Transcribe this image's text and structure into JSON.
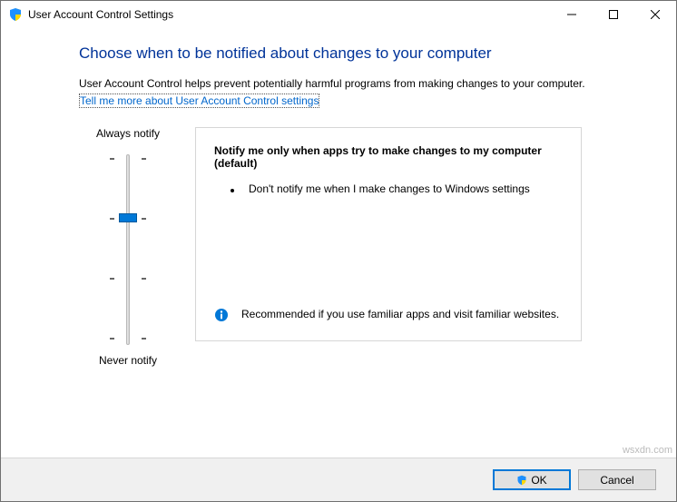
{
  "title": "User Account Control Settings",
  "heading": "Choose when to be notified about changes to your computer",
  "description": "User Account Control helps prevent potentially harmful programs from making changes to your computer.",
  "link": "Tell me more about User Account Control settings",
  "slider": {
    "top_label": "Always notify",
    "bottom_label": "Never notify",
    "levels": 4,
    "current_level": 2
  },
  "panel": {
    "title": "Notify me only when apps try to make changes to my computer (default)",
    "bullet": "Don't notify me when I make changes to Windows settings",
    "recommendation": "Recommended if you use familiar apps and visit familiar websites."
  },
  "buttons": {
    "ok": "OK",
    "cancel": "Cancel"
  },
  "watermark": "wsxdn.com"
}
